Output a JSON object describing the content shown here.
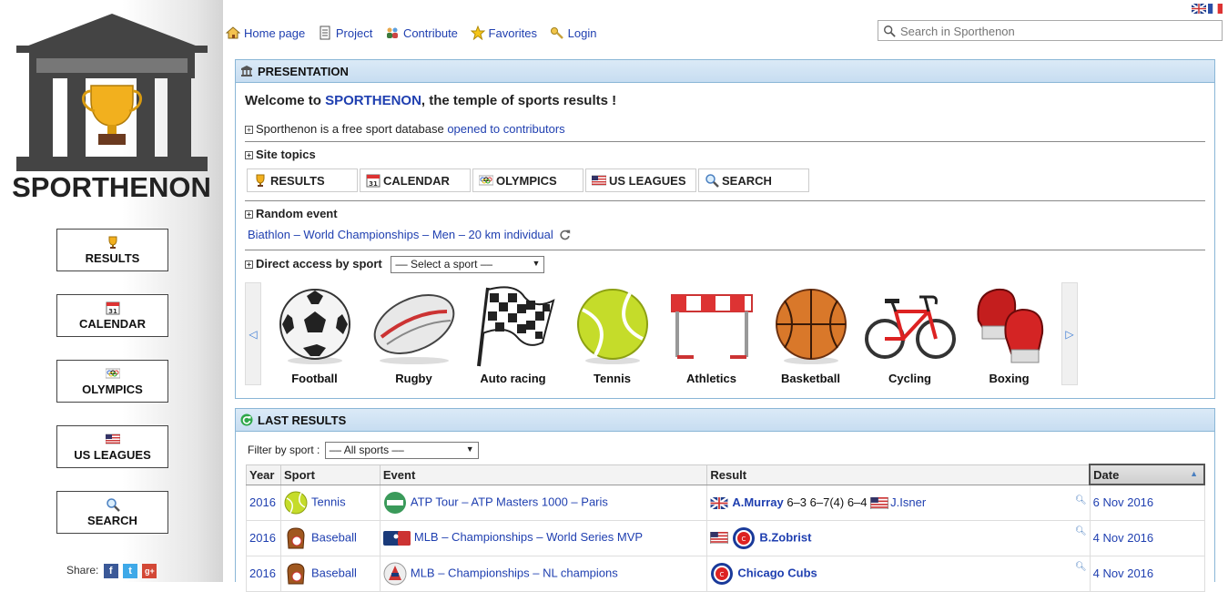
{
  "site": {
    "name": "SPORTHENON"
  },
  "nav": {
    "items": [
      {
        "label": "Home page",
        "icon": "home-icon"
      },
      {
        "label": "Project",
        "icon": "document-icon"
      },
      {
        "label": "Contribute",
        "icon": "users-icon"
      },
      {
        "label": "Favorites",
        "icon": "star-icon"
      },
      {
        "label": "Login",
        "icon": "key-icon"
      }
    ],
    "search_placeholder": "Search in Sporthenon"
  },
  "sidebar": {
    "buttons": [
      {
        "label": "RESULTS",
        "icon": "trophy-icon"
      },
      {
        "label": "CALENDAR",
        "icon": "calendar-icon"
      },
      {
        "label": "OLYMPICS",
        "icon": "olympic-rings-icon"
      },
      {
        "label": "US LEAGUES",
        "icon": "us-flag-icon"
      },
      {
        "label": "SEARCH",
        "icon": "magnifier-icon"
      }
    ],
    "share_label": "Share:"
  },
  "presentation": {
    "title": "PRESENTATION",
    "welcome_prefix": "Welcome to ",
    "welcome_brand": "SPORTHENON",
    "welcome_suffix": ", the temple of sports results !",
    "intro_text": "Sporthenon is a free sport database ",
    "intro_link": "opened to contributors",
    "site_topics_title": "Site topics",
    "topics": [
      {
        "label": "RESULTS",
        "icon": "trophy-icon"
      },
      {
        "label": "CALENDAR",
        "icon": "calendar-icon"
      },
      {
        "label": "OLYMPICS",
        "icon": "olympic-rings-icon"
      },
      {
        "label": "US LEAGUES",
        "icon": "us-flag-icon"
      },
      {
        "label": "SEARCH",
        "icon": "magnifier-icon"
      }
    ],
    "random_title": "Random event",
    "random_event": "Biathlon – World Championships – Men – 20 km individual",
    "direct_title": "Direct access by sport",
    "sport_select": "–– Select a sport ––",
    "sports": [
      "Football",
      "Rugby",
      "Auto racing",
      "Tennis",
      "Athletics",
      "Basketball",
      "Cycling",
      "Boxing"
    ]
  },
  "last_results": {
    "title": "LAST RESULTS",
    "filter_label": "Filter by sport :",
    "filter_value": "–– All sports ––",
    "columns": [
      "Year",
      "Sport",
      "Event",
      "Result",
      "Date"
    ],
    "rows": [
      {
        "year": "2016",
        "sport": "Tennis",
        "event": "ATP Tour – ATP Masters 1000 – Paris",
        "winner": "A.Murray",
        "score": "6–3 6–7(4) 6–4",
        "runnerup": "J.Isner",
        "date": "6 Nov 2016"
      },
      {
        "year": "2016",
        "sport": "Baseball",
        "event": "MLB – Championships – World Series MVP",
        "winner": "B.Zobrist",
        "score": "",
        "runnerup": "",
        "date": "4 Nov 2016"
      },
      {
        "year": "2016",
        "sport": "Baseball",
        "event": "MLB – Championships – NL champions",
        "winner": "Chicago Cubs",
        "score": "",
        "runnerup": "",
        "date": "4 Nov 2016"
      }
    ]
  },
  "colors": {
    "link": "#1f3fb0",
    "panel_border": "#8ab6d6",
    "panel_header": "#c7ddf1"
  }
}
